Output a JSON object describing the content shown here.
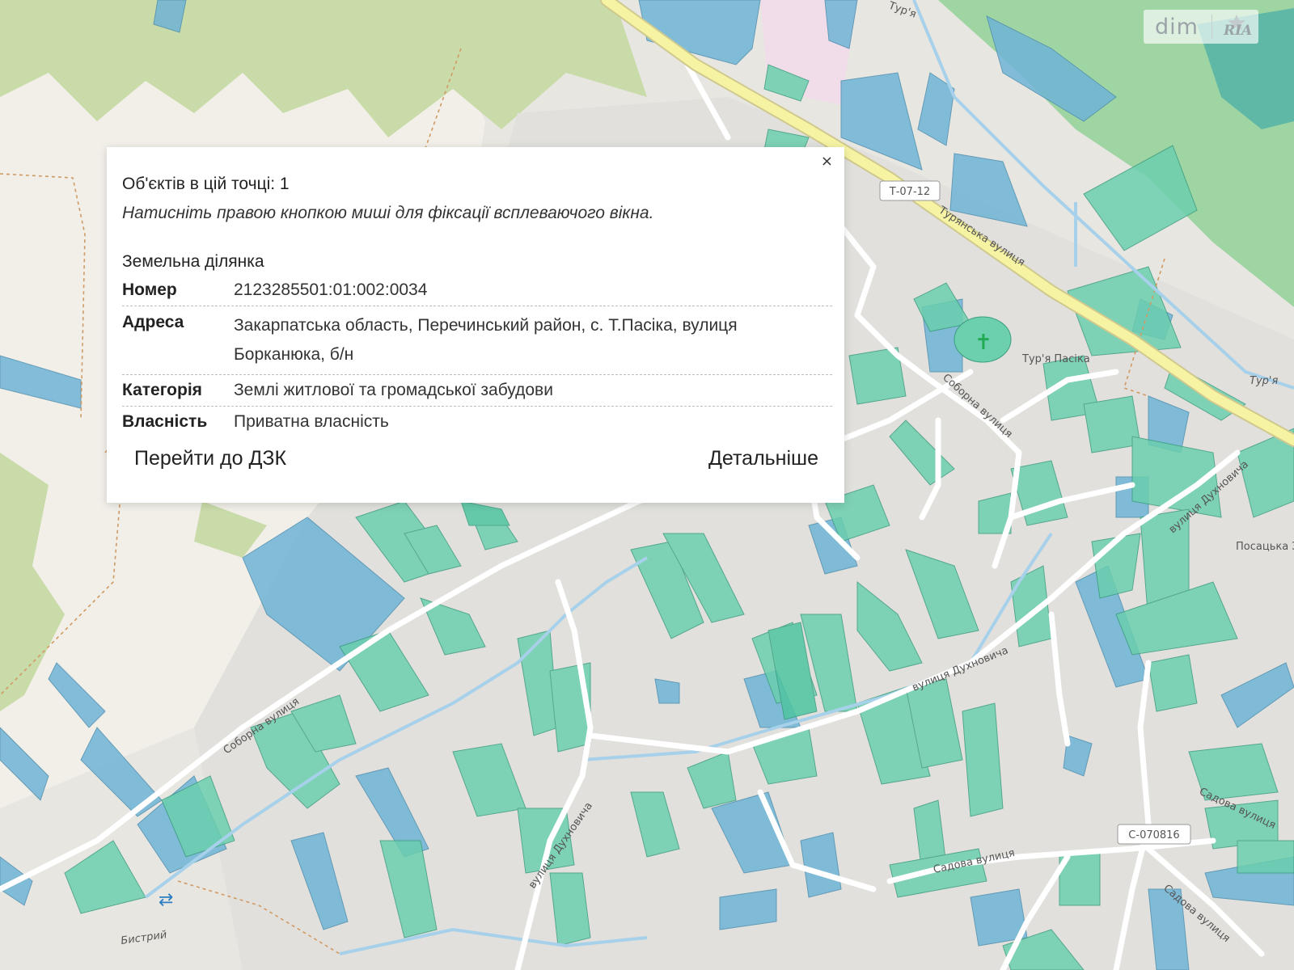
{
  "map": {
    "labels": {
      "road_ref_1": "Т-07-12",
      "road_ref_2": "С-070816",
      "street_turianska": "Турянська вулиця",
      "street_soborna_top": "Соборна вулиця",
      "street_soborna_left": "Соборна вулиця",
      "street_dukhnovycha_1": "вулиця Духновича",
      "street_dukhnovycha_2": "вулиця Духновича",
      "street_dukhnovycha_3": "вулиця Духновича",
      "street_sadova_1": "Садова вулиця",
      "street_sadova_2": "Садова вулиця",
      "street_sadova_3": "Садова вулиця",
      "village": "Тур'я Пасіка",
      "river_1": "Тур'я",
      "river_2": "Тур'я",
      "river_3": "Бистрий",
      "school": "Посацька ЗОШ"
    },
    "colors": {
      "background": "#e8e6e1",
      "forest": "#9fd4a3",
      "green_light": "#c9dba9",
      "parcel_teal": "#6ccfae",
      "parcel_blue": "#6fb4d6",
      "road_main": "#f6f3a3",
      "industrial": "#f1dde9"
    }
  },
  "watermark": {
    "dim": "dim",
    "ria": "RIA"
  },
  "popup": {
    "close": "×",
    "objects_count": "Об'єктів в цій точці: 1",
    "hint": "Натисніть правою кнопкою миші для фіксації всплеваючого вікна.",
    "section_title": "Земельна ділянка",
    "rows": [
      {
        "key": "Номер",
        "value": "2123285501:01:002:0034"
      },
      {
        "key": "Адреса",
        "value": "Закарпатська область, Перечинський район, с. Т.Пасіка, вулиця Борканюка, б/н"
      },
      {
        "key": "Категорія",
        "value": "Землі житлової та громадської забудови"
      },
      {
        "key": "Власність",
        "value": "Приватна власність"
      }
    ],
    "btn_dzk": "Перейти до ДЗК",
    "btn_details": "Детальніше"
  }
}
